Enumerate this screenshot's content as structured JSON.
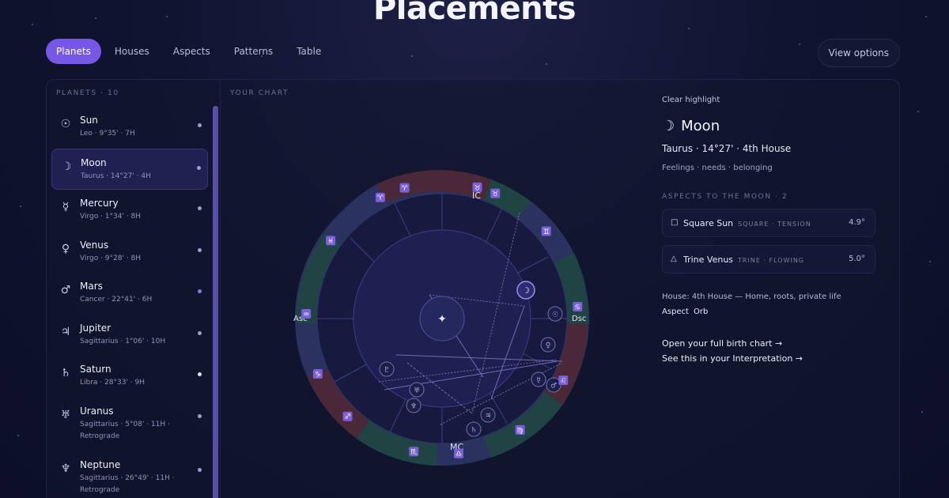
{
  "page": {
    "title": "Placements"
  },
  "tabs": [
    {
      "label": "Planets",
      "active": true
    },
    {
      "label": "Houses",
      "active": false
    },
    {
      "label": "Aspects",
      "active": false
    },
    {
      "label": "Patterns",
      "active": false
    },
    {
      "label": "Table",
      "active": false
    }
  ],
  "toolbar": {
    "view_options_label": "View options"
  },
  "sidebar": {
    "section_label": "PLANETS · 10",
    "items": [
      {
        "glyph": "☉",
        "icon": "sun-icon",
        "name": "Sun",
        "detail": "Leo · 9°35' · 7H",
        "detail2": "",
        "selected": false
      },
      {
        "glyph": "☽",
        "icon": "moon-icon",
        "name": "Moon",
        "detail": "Taurus · 14°27' · 4H",
        "detail2": "",
        "selected": true
      },
      {
        "glyph": "☿",
        "icon": "mercury-icon",
        "name": "Mercury",
        "detail": "Virgo · 1°34' · 8H",
        "detail2": "",
        "selected": false
      },
      {
        "glyph": "♀",
        "icon": "venus-icon",
        "name": "Venus",
        "detail": "Virgo · 9°28' · 8H",
        "detail2": "",
        "selected": false
      },
      {
        "glyph": "♂",
        "icon": "mars-icon",
        "name": "Mars",
        "detail": "Cancer · 22°41' · 6H",
        "detail2": "",
        "selected": false
      },
      {
        "glyph": "♃",
        "icon": "jupiter-icon",
        "name": "Jupiter",
        "detail": "Sagittarius · 1°06' · 10H",
        "detail2": "",
        "selected": false
      },
      {
        "glyph": "♄",
        "icon": "saturn-icon",
        "name": "Saturn",
        "detail": "Libra · 28°33' · 9H",
        "detail2": "",
        "selected": false
      },
      {
        "glyph": "♅",
        "icon": "uranus-icon",
        "name": "Uranus",
        "detail": "Sagittarius · 5°08' · 11H ·",
        "detail2": "Retrograde",
        "selected": false
      },
      {
        "glyph": "♆",
        "icon": "neptune-icon",
        "name": "Neptune",
        "detail": "Sagittarius · 26°49' · 11H ·",
        "detail2": "Retrograde",
        "selected": false
      }
    ]
  },
  "chart": {
    "section_label": "YOUR CHART",
    "angles": {
      "ic": "IC",
      "mc": "MC",
      "asc": "Asc",
      "dsc": "Dsc"
    },
    "center_glyph": "✦",
    "moon_glyph": "☽",
    "zodiac_glyphs": [
      "♈",
      "♉",
      "♊",
      "♋",
      "♌",
      "♍",
      "♎",
      "♏",
      "♐",
      "♑",
      "♒",
      "♓",
      "♈",
      "♉"
    ],
    "planet_glyphs": [
      "☉",
      "♀",
      "☿",
      "♂",
      "♃",
      "♄",
      "♅",
      "♆",
      "♇"
    ],
    "colors": {
      "accent": "#7657e6",
      "ring_green": "#1f4443",
      "ring_red": "#4a2838",
      "ring_blue": "#2a3360",
      "glyph_bg": "#7b5fd8"
    }
  },
  "details": {
    "clear_label": "Clear highlight",
    "title_glyph": "☽",
    "title": "Moon",
    "subtitle": "Taurus · 14°27' · 4th House",
    "keywords": "Feelings · needs · belonging",
    "aspects_label": "ASPECTS TO THE MOON · 2",
    "aspects": [
      {
        "glyph": "□",
        "icon": "square-aspect-icon",
        "name": "Square Sun",
        "meta": "SQUARE · TENSION",
        "orb": "4.9°"
      },
      {
        "glyph": "△",
        "icon": "trine-aspect-icon",
        "name": "Trine Venus",
        "meta": "TRINE · FLOWING",
        "orb": "5.0°"
      }
    ],
    "house_info": "House: 4th House — Home, roots, private life",
    "aspect_word": "Aspect",
    "orb_word": "Orb",
    "links": [
      "Open your full birth chart →",
      "See this in your Interpretation →"
    ]
  }
}
